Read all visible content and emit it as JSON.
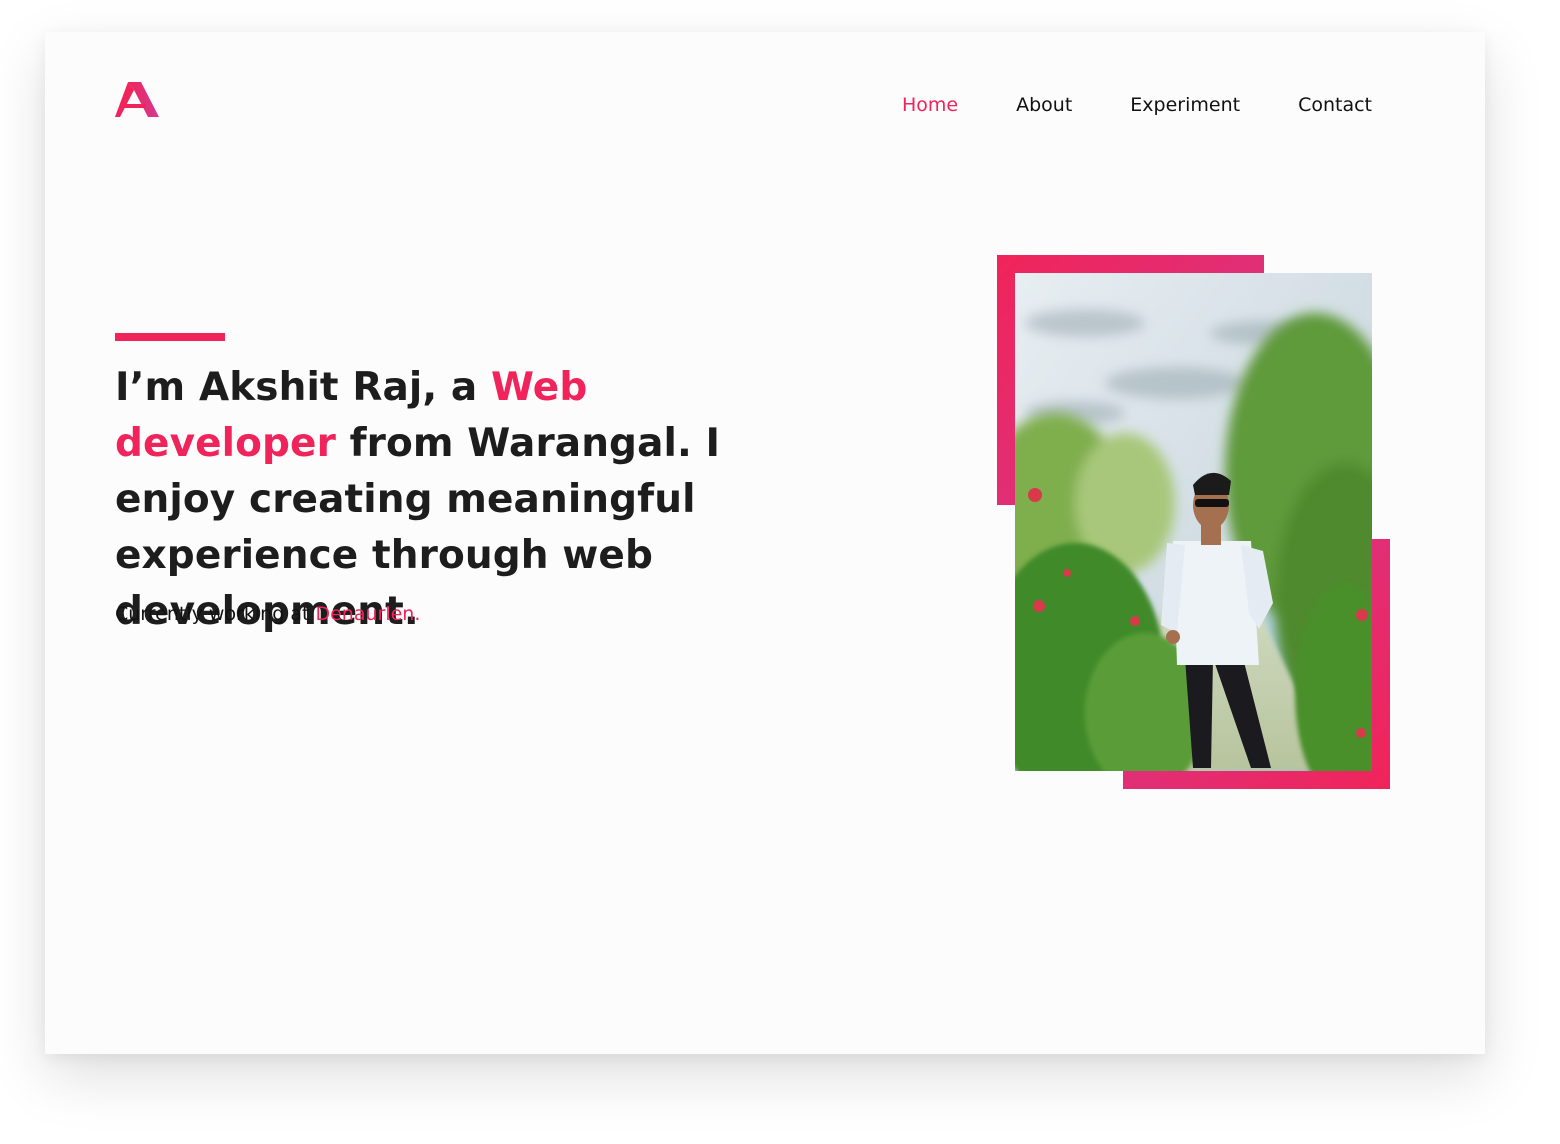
{
  "header": {
    "logo_letter": "A",
    "nav": [
      {
        "label": "Home",
        "active": true
      },
      {
        "label": "About",
        "active": false
      },
      {
        "label": "Experiment",
        "active": false
      },
      {
        "label": "Contact",
        "active": false
      }
    ]
  },
  "hero": {
    "headline_prefix": "I’m Akshit Raj, a ",
    "headline_highlight": "Web developer",
    "headline_suffix": " from Warangal. I enjoy creating meaningful experience through web development.",
    "subline_prefix": "Currently working at ",
    "company": "Denaurlen."
  },
  "colors": {
    "accent": "#f0245a",
    "accent_secondary": "#d23b92",
    "text": "#1d1d1d",
    "background": "#fcfcfc"
  }
}
